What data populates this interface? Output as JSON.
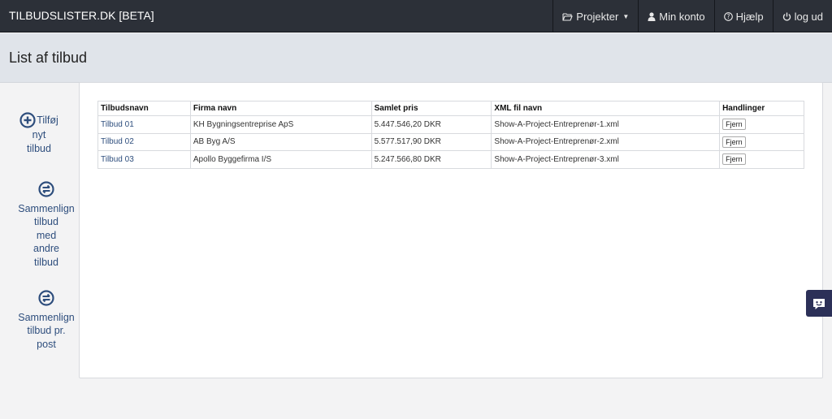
{
  "navbar": {
    "brand": "TILBUDSLISTER.DK [BETA]",
    "items": [
      {
        "label": "Projekter",
        "icon": "folder-open-icon",
        "dropdown": true
      },
      {
        "label": "Min konto",
        "icon": "user-icon"
      },
      {
        "label": "Hjælp",
        "icon": "question-circle-icon"
      },
      {
        "label": "log ud",
        "icon": "power-icon"
      }
    ]
  },
  "page": {
    "title": "List af tilbud"
  },
  "sidebar": {
    "add": {
      "line1": "Tilføj",
      "line2": "nyt",
      "line3": "tilbud",
      "icon": "plus-circle-icon"
    },
    "compare": {
      "lines": [
        "Sammenlign",
        "tilbud",
        "med",
        "andre",
        "tilbud"
      ],
      "icon": "exchange-circle-icon"
    },
    "compare_post": {
      "lines": [
        "Sammenlign",
        "tilbud pr.",
        "post"
      ],
      "icon": "exchange-circle-icon"
    }
  },
  "table": {
    "headers": [
      "Tilbudsnavn",
      "Firma navn",
      "Samlet pris",
      "XML fil navn",
      "Handlinger"
    ],
    "rows": [
      {
        "name": "Tilbud 01",
        "firm": "KH Bygningsentreprise ApS",
        "price": "5.447.546,20 DKR",
        "xml": "Show-A-Project-Entreprenør-1.xml",
        "action": "Fjern"
      },
      {
        "name": "Tilbud 02",
        "firm": "AB Byg A/S",
        "price": "5.577.517,90 DKR",
        "xml": "Show-A-Project-Entreprenør-2.xml",
        "action": "Fjern"
      },
      {
        "name": "Tilbud 03",
        "firm": "Apollo Byggefirma I/S",
        "price": "5.247.566,80 DKR",
        "xml": "Show-A-Project-Entreprenør-3.xml",
        "action": "Fjern"
      }
    ]
  },
  "chat": {
    "icon": "chat-bubble-icon"
  },
  "colors": {
    "navbar": "#2c3038",
    "link": "#2e4e7d",
    "header_band": "#e0e4ea",
    "chat": "#2c3058"
  }
}
